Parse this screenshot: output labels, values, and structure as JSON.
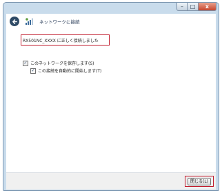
{
  "window": {
    "min_glyph": "–",
    "max_glyph": "□",
    "close_glyph": "x"
  },
  "header": {
    "title": "ネットワークに接続"
  },
  "content": {
    "status_message": "RX501NC_XXXX に正しく接続しました",
    "save_network_label": "このネットワークを保存します(S)",
    "save_network_checked": true,
    "auto_connect_label": "この接続を自動的に開始します(T)",
    "auto_connect_checked": true,
    "check_mark": "✓"
  },
  "footer": {
    "close_label": "閉じる(L)"
  },
  "colors": {
    "highlight": "#c0182a",
    "chrome": "#c9dcec",
    "header_text": "#1e3250"
  },
  "icons": {
    "back": "back-arrow-icon",
    "network": "network-icon"
  }
}
